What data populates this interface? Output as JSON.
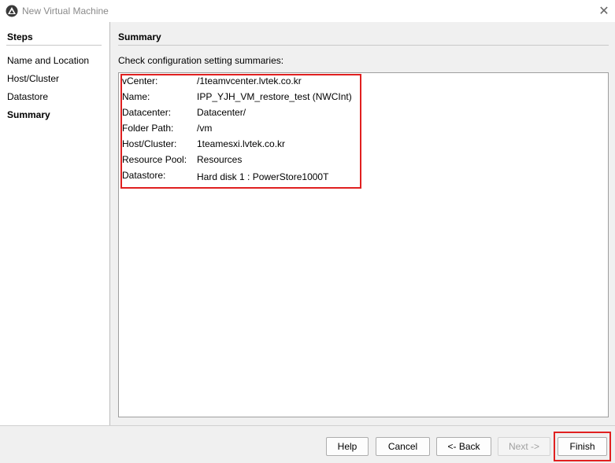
{
  "window": {
    "title": "New Virtual Machine",
    "close_glyph": "✕"
  },
  "steps": {
    "header": "Steps",
    "items": [
      {
        "label": "Name and Location",
        "active": false
      },
      {
        "label": "Host/Cluster",
        "active": false
      },
      {
        "label": "Datastore",
        "active": false
      },
      {
        "label": "Summary",
        "active": true
      }
    ]
  },
  "summary": {
    "header": "Summary",
    "instruction": "Check configuration setting summaries:",
    "rows": [
      {
        "label": "vCenter:",
        "value": "/1teamvcenter.lvtek.co.kr"
      },
      {
        "label": "Name:",
        "value": "IPP_YJH_VM_restore_test (NWCInt)"
      },
      {
        "label": "Datacenter:",
        "value": "Datacenter/"
      },
      {
        "label": "Folder Path:",
        "value": "/vm"
      },
      {
        "label": "Host/Cluster:",
        "value": "1teamesxi.lvtek.co.kr"
      },
      {
        "label": "Resource Pool:",
        "value": "Resources"
      },
      {
        "label": "Datastore:",
        "value": "Hard disk 1 : PowerStore1000T"
      }
    ]
  },
  "buttons": {
    "help": "Help",
    "cancel": "Cancel",
    "back": "<- Back",
    "next": "Next ->",
    "finish": "Finish"
  },
  "colors": {
    "highlight": "#e02020"
  }
}
